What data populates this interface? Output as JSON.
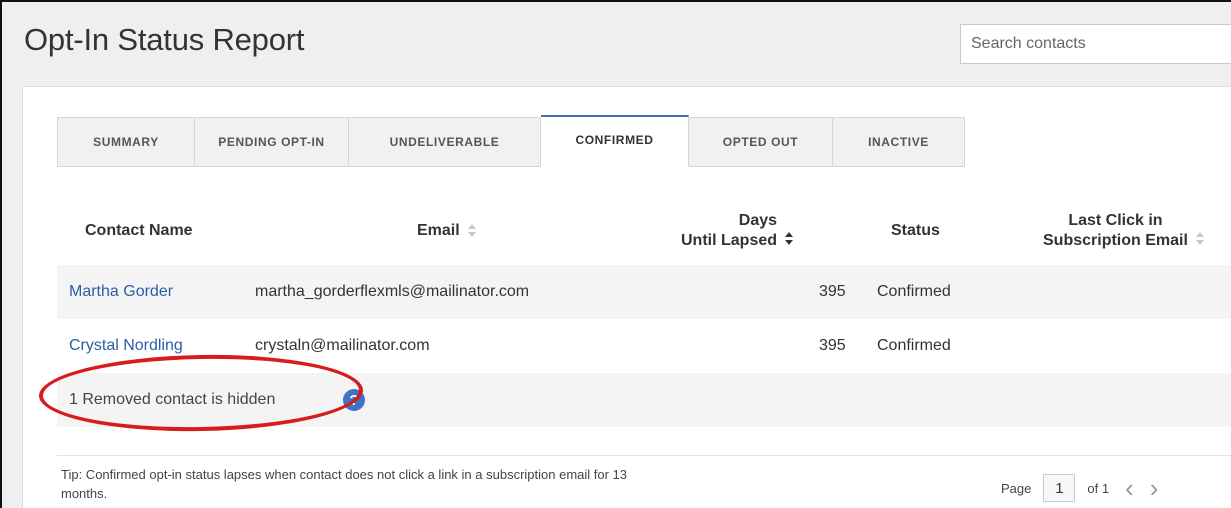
{
  "page": {
    "title": "Opt-In Status Report"
  },
  "search": {
    "placeholder": "Search contacts"
  },
  "tabs": [
    {
      "label": "SUMMARY",
      "active": false
    },
    {
      "label": "PENDING OPT-IN",
      "active": false
    },
    {
      "label": "UNDELIVERABLE",
      "active": false
    },
    {
      "label": "CONFIRMED",
      "active": true
    },
    {
      "label": "OPTED OUT",
      "active": false
    },
    {
      "label": "INACTIVE",
      "active": false
    }
  ],
  "table": {
    "columns": {
      "name": "Contact Name",
      "email": "Email",
      "days": "Days\nUntil Lapsed",
      "status": "Status",
      "last_click": "Last Click in\nSubscription Email"
    },
    "rows": [
      {
        "name": "Martha Gorder",
        "email": "martha_gorderflexmls@mailinator.com",
        "days": "395",
        "status": "Confirmed",
        "last_click": ""
      },
      {
        "name": "Crystal Nordling",
        "email": "crystaln@mailinator.com",
        "days": "395",
        "status": "Confirmed",
        "last_click": ""
      }
    ]
  },
  "hidden_notice": {
    "text": "1 Removed contact is hidden",
    "help_glyph": "?"
  },
  "tip": {
    "text": "Tip: Confirmed opt-in status lapses when contact does not click a link in a subscription email for 13 months."
  },
  "pagination": {
    "page_label": "Page",
    "current": "1",
    "of_label": "of 1",
    "prev_glyph": "‹",
    "next_glyph": "›"
  },
  "colors": {
    "accent": "#3a6fb5",
    "link": "#2b5ea7",
    "highlight": "#d81b1b",
    "help_icon": "#3f74c4"
  },
  "icons": {
    "help": "question-circle-icon",
    "sort": "sort-arrows-icon",
    "prev": "chevron-left-icon",
    "next": "chevron-right-icon"
  }
}
